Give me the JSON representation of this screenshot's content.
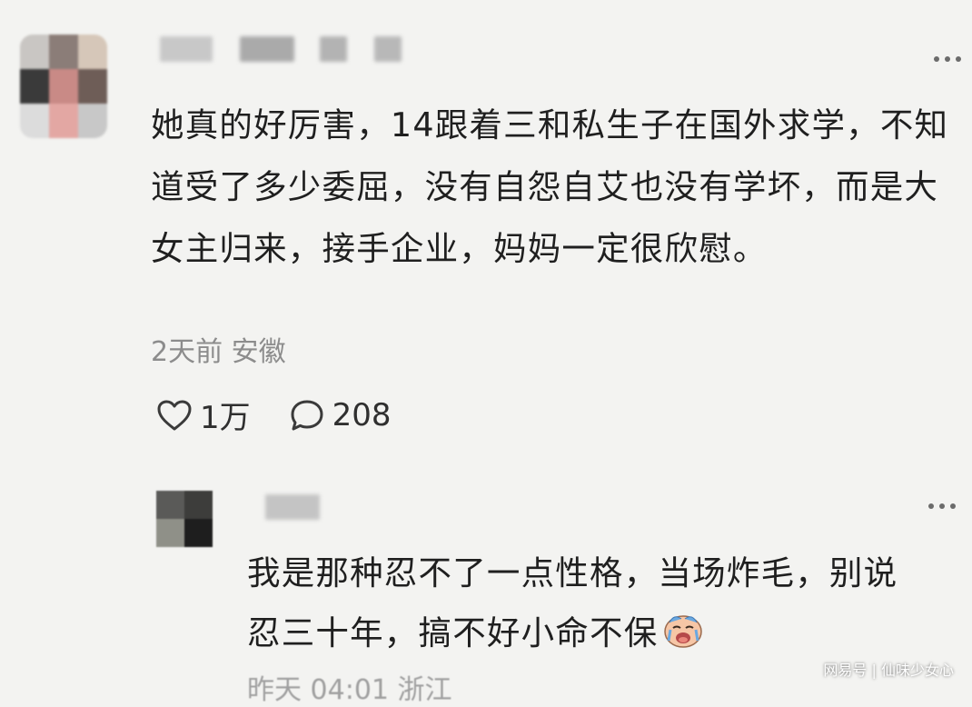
{
  "main_comment": {
    "text": "她真的好厉害，14跟着三和私生子在国外求学，不知道受了多少委屈，没有自怨自艾也没有学坏，而是大女主归来，接手企业，妈妈一定很欣慰。",
    "meta": "2天前 安徽",
    "likes": "1万",
    "replies": "208",
    "like_icon": "heart-outline-icon",
    "comment_icon": "speech-bubble-icon"
  },
  "reply_comment": {
    "line1": "我是那种忍不了一点性格，当场炸毛，别说",
    "line2": "忍三十年，搞不好小命不保",
    "emoji": "crying-face-emoji",
    "meta": "昨天 04:01 浙江"
  },
  "watermark": "网易号 | 仙味少女心",
  "colors": {
    "background": "#f3f3f1",
    "text": "#1f1f1f",
    "meta": "#8c8c8c"
  }
}
